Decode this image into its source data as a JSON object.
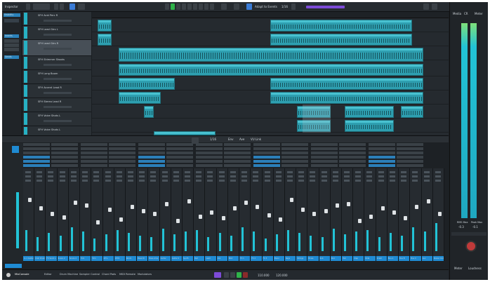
{
  "colors": {
    "accent_audio": "#2e9fb0",
    "active_green": "#2fb34a",
    "channel_blue": "#1f8bd3",
    "purple": "#7d4bd8"
  },
  "toolbar": {
    "left_label": "Inspector",
    "snap_label": "Adapt to Events",
    "zoom_value": "1/16",
    "right_labels": [
      "Media",
      "CR",
      "Meter"
    ]
  },
  "left_zone": {
    "section_labels": [
      "Visibility",
      "Inserts",
      "Sends"
    ]
  },
  "tracks": [
    {
      "name": "SFH Acid Perc R"
    },
    {
      "name": "SFH Lead Gtrs L"
    },
    {
      "name": "SFH Lead Gtrs R"
    },
    {
      "name": "SFH Shimmer Shoots"
    },
    {
      "name": "SFH Long Boom"
    },
    {
      "name": "SFH Accent Lead R"
    },
    {
      "name": "SFH Stereo Lead R"
    },
    {
      "name": "SFH Voice Shots L"
    },
    {
      "name": "SFH Voice Shots L"
    }
  ],
  "mixer": {
    "toolbar_labels": [
      "1/16",
      "Env",
      "Ave",
      "VU Link"
    ],
    "routing_label": "Routing",
    "channels": [
      "In 1 Guitar 1",
      "Crsh Drums",
      "FX Send L",
      "Snare 2",
      "Snare 4",
      "Tom",
      "Tom",
      "OH L",
      "OH R",
      "Room",
      "Bass DI",
      "Bass Amp",
      "Guitar",
      "Guitar 2",
      "Synth",
      "Pad",
      "Lead",
      "Vox",
      "BGV",
      "FX 1",
      "FX 2",
      "FX 3",
      "Piano",
      "Keys",
      "Strings",
      "Brass",
      "Sub",
      "Perc",
      "Hat",
      "Clap",
      "Ride",
      "Crash",
      "Bus A",
      "Bus B",
      "Bus C",
      "Aux",
      "Stereo Out"
    ],
    "output_label": "Stereo Out"
  },
  "meters": {
    "values": [
      "-0.3",
      "-0.1"
    ],
    "labels": [
      "RMS Max",
      "Peak Max"
    ]
  },
  "bottom_tabs": [
    "MixConsole",
    "Editor",
    "Drum Machine",
    "Sampler Control",
    "Chord Pads",
    "MIDI Remote",
    "Modulators"
  ],
  "transport": {
    "position": "110.000",
    "tempo": "120.000"
  },
  "right_bottom": {
    "tab1": "Meter",
    "tab2": "Loudness"
  }
}
